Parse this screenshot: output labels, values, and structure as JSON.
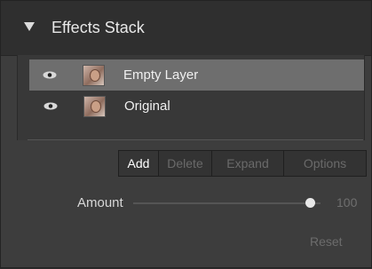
{
  "panel": {
    "title": "Effects Stack"
  },
  "layers": [
    {
      "name": "Empty Layer",
      "selected": true,
      "visible": true,
      "icon": "eye-icon"
    },
    {
      "name": "Original",
      "selected": false,
      "visible": true,
      "icon": "eye-icon"
    }
  ],
  "toolbar": {
    "add_label": "Add",
    "delete_label": "Delete",
    "expand_label": "Expand",
    "options_label": "Options"
  },
  "amount": {
    "label": "Amount",
    "value": "100",
    "level": 1.0
  },
  "reset_label": "Reset",
  "colors": {
    "panel_bg": "#3d3d3d",
    "selected_row": "#6e6e6e",
    "disabled_text": "#6a6a6a"
  }
}
